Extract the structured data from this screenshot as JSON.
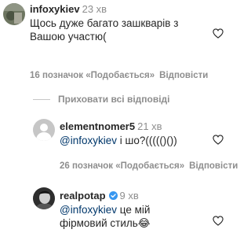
{
  "comment": {
    "username": "infoxykiev",
    "time": "23 хв",
    "text_line1": "Щось дуже багато зашкварів з",
    "text_line2": "Вашою участю(",
    "likes": "16 позначок «Подобається»",
    "reply": "Відповісти"
  },
  "hide_replies": "Приховати всі відповіді",
  "replies": [
    {
      "username": "elementnomer5",
      "time": "21 хв",
      "mention": "@infoxykiev",
      "text": " і шо?((((()())",
      "likes": "26 позначок «Подобається»",
      "reply": "Відповісти"
    },
    {
      "username": "realpotap",
      "time": "9 хв",
      "mention": "@infoxykiev",
      "text_line1": " це мій",
      "text_line2": "фірмовий стиль",
      "emoji": "😂"
    }
  ]
}
